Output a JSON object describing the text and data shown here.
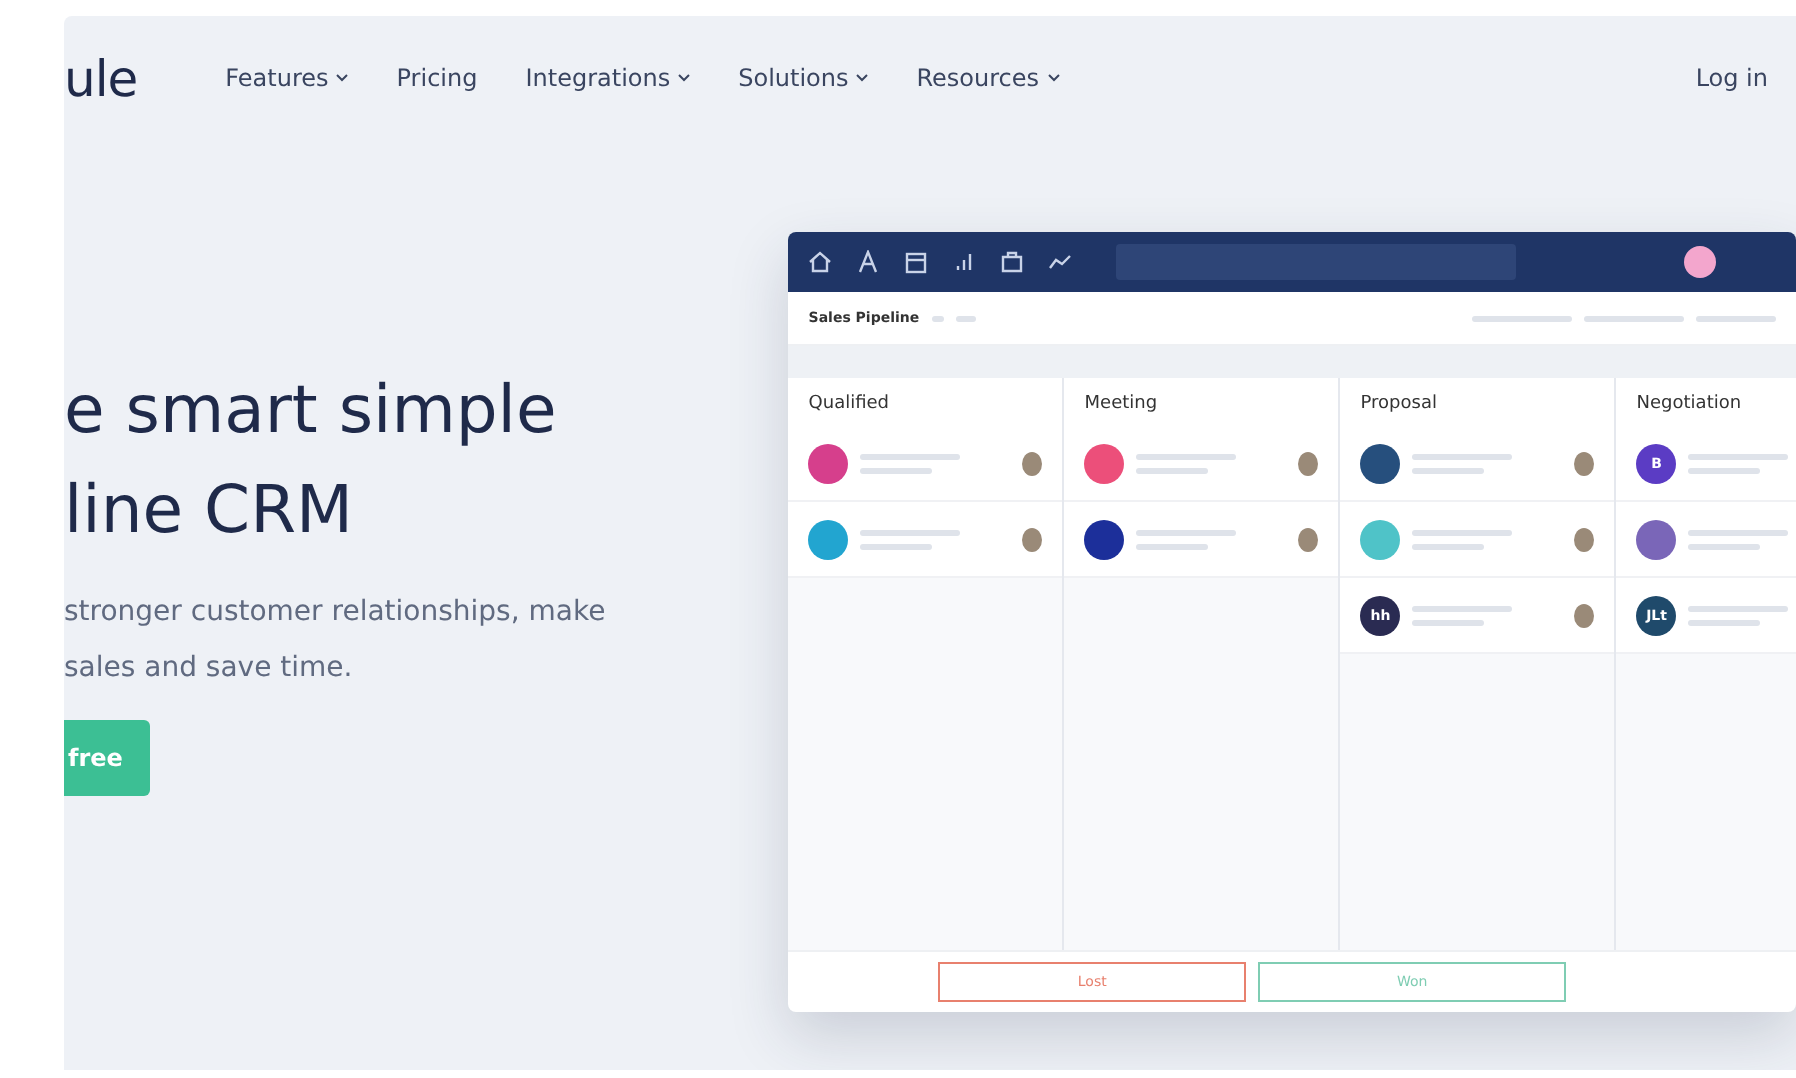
{
  "logo": "ule",
  "nav": [
    {
      "label": "Features",
      "dropdown": true
    },
    {
      "label": "Pricing",
      "dropdown": false
    },
    {
      "label": "Integrations",
      "dropdown": true
    },
    {
      "label": "Solutions",
      "dropdown": true
    },
    {
      "label": "Resources",
      "dropdown": true
    }
  ],
  "login": "Log in",
  "hero": {
    "headline": [
      "e smart simple",
      "line CRM"
    ],
    "subtext": [
      "stronger customer relationships, make",
      "sales and save time."
    ],
    "cta": "free"
  },
  "app": {
    "title": "Sales Pipeline",
    "columns": [
      {
        "name": "Qualified",
        "deals": [
          {
            "color": "#d63f8c"
          },
          {
            "color": "#22a5d0"
          }
        ]
      },
      {
        "name": "Meeting",
        "deals": [
          {
            "color": "#ec4f7a"
          },
          {
            "color": "#1c2f9a"
          }
        ]
      },
      {
        "name": "Proposal",
        "deals": [
          {
            "color": "#264f7d"
          },
          {
            "color": "#4fc3c8"
          },
          {
            "color": "#2a2b52",
            "logo_text": "hh"
          }
        ]
      },
      {
        "name": "Negotiation",
        "deals": [
          {
            "color": "#5b3cc4",
            "logo_text": "B"
          },
          {
            "color": "#7a66b8"
          },
          {
            "color": "#1f4a6b",
            "logo_text": "JLt"
          }
        ]
      }
    ],
    "lost": "Lost",
    "won": "Won"
  }
}
